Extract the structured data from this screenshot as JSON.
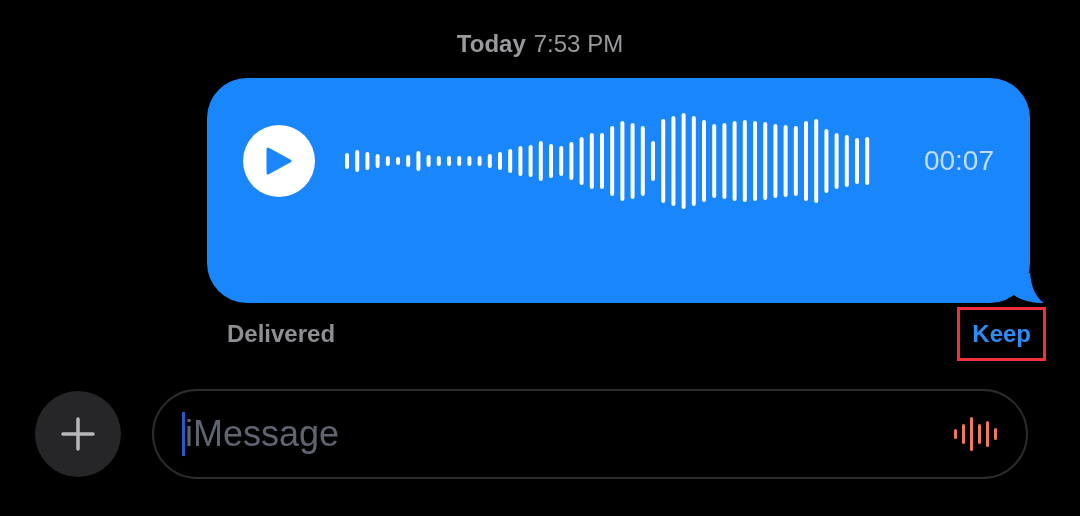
{
  "timestamp": {
    "day": "Today",
    "time": "7:53 PM"
  },
  "voice_message": {
    "duration": "00:07"
  },
  "status": "Delivered",
  "keep_button": {
    "label": "Keep",
    "highlighted": true
  },
  "composer": {
    "placeholder": "iMessage"
  }
}
